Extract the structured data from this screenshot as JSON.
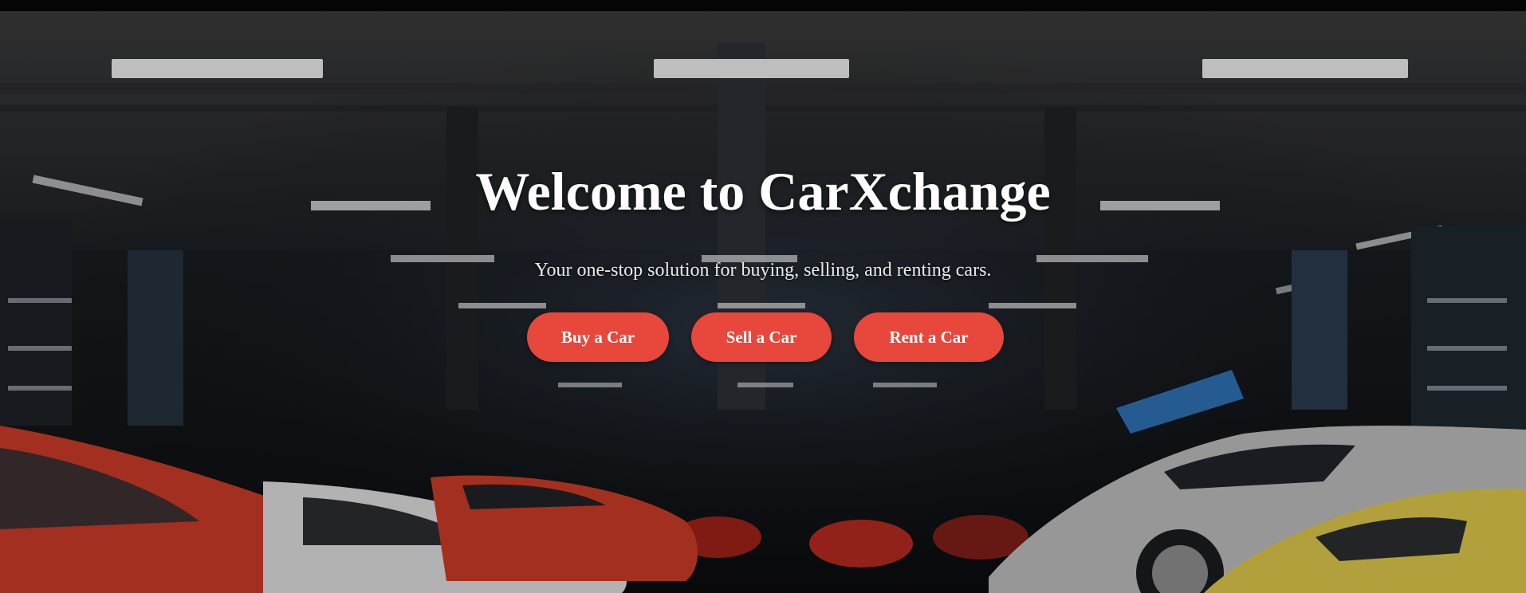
{
  "hero": {
    "title": "Welcome to CarXchange",
    "subtitle": "Your one-stop solution for buying, selling, and renting cars.",
    "background": "dark-garage-showroom-with-sports-cars"
  },
  "actions": {
    "buy_label": "Buy a Car",
    "sell_label": "Sell a Car",
    "rent_label": "Rent a Car"
  },
  "colors": {
    "button_bg": "#e8473b",
    "button_text": "#ffffff",
    "title_text": "#ffffff"
  }
}
